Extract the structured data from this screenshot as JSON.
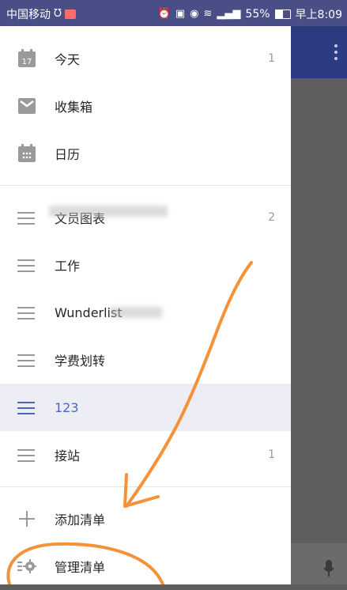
{
  "status": {
    "carrier": "中国移动",
    "battery": "55%",
    "time": "早上8:09",
    "icons": [
      "shield-icon",
      "notification-icon",
      "alarm-icon",
      "hd-icon",
      "eye-icon",
      "wifi-icon",
      "signal-icon",
      "battery-icon"
    ]
  },
  "drawer": {
    "smart": [
      {
        "label": "今天",
        "count": "1",
        "icon": "calendar-today-icon"
      },
      {
        "label": "收集箱",
        "count": "",
        "icon": "inbox-icon"
      },
      {
        "label": "日历",
        "count": "",
        "icon": "calendar-icon"
      }
    ],
    "lists": [
      {
        "label": "文员图表",
        "count": "2"
      },
      {
        "label": "工作",
        "count": ""
      },
      {
        "label": "Wunderlist",
        "count": ""
      },
      {
        "label": "学费划转",
        "count": ""
      },
      {
        "label": "123",
        "count": "",
        "selected": true
      },
      {
        "label": "接站",
        "count": "1"
      }
    ],
    "actions": {
      "add_label": "添加清单",
      "manage_label": "管理清单"
    },
    "calendar_day": "17"
  },
  "colors": {
    "accent": "#4b68b6",
    "appbar": "#2c3a82",
    "annotation": "#f4923a"
  }
}
